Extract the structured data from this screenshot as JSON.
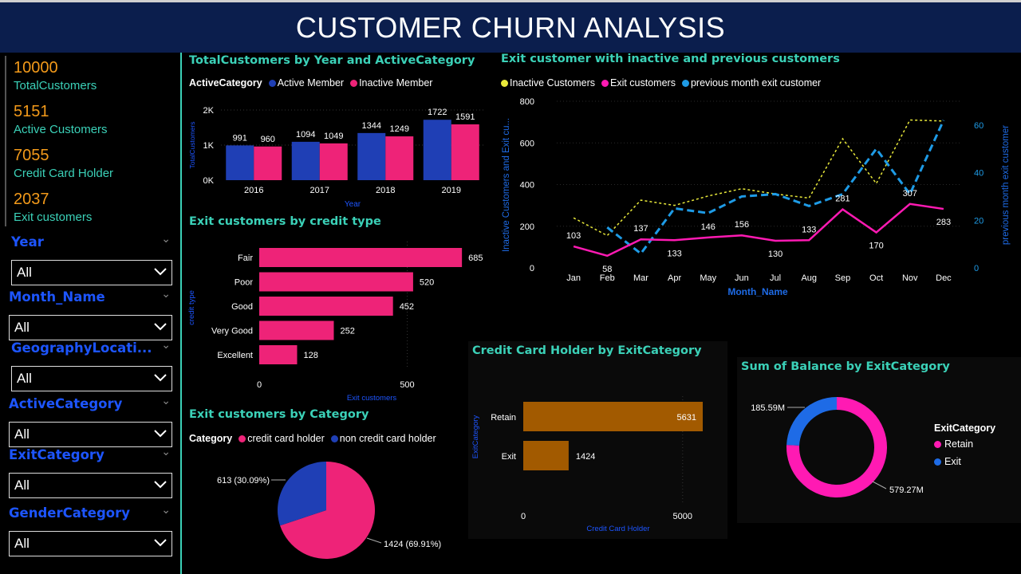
{
  "header": {
    "title": "CUSTOMER CHURN ANALYSIS"
  },
  "kpis": [
    {
      "value": "10000",
      "label": "TotalCustomers"
    },
    {
      "value": "5151",
      "label": "Active Customers"
    },
    {
      "value": "7055",
      "label": "Credit Card Holder"
    },
    {
      "value": "2037",
      "label": "Exit customers"
    }
  ],
  "slicers": [
    {
      "title": "Year",
      "value": "All"
    },
    {
      "title": "Month_Name",
      "value": "All"
    },
    {
      "title": "GeographyLocati...",
      "value": "All"
    },
    {
      "title": "ActiveCategory",
      "value": "All"
    },
    {
      "title": "ExitCategory",
      "value": "All"
    },
    {
      "title": "GenderCategory",
      "value": "All"
    }
  ],
  "colors": {
    "accent": "#3bd1b8",
    "kpi": "#f39a1a",
    "slicer": "#1d55ff",
    "blue": "#1f3fb5",
    "pink": "#ee2378",
    "magenta": "#ff1ab3",
    "yellow": "#e8e83a",
    "cyan": "#1e9be6",
    "brown": "#a25a00"
  },
  "charts": {
    "year_active": {
      "title": "TotalCustomers by Year and ActiveCategory",
      "legend_title": "ActiveCategory",
      "ylabel": "TotalCustomers",
      "xlabel": "Year",
      "yticks": [
        "0K",
        "1K",
        "2K"
      ]
    },
    "credit_type": {
      "title": "Exit customers by credit type",
      "ylabel": "credit type",
      "xlabel": "Exit customers",
      "xticks": [
        "0",
        "500"
      ]
    },
    "category_pie": {
      "title": "Exit customers by Category",
      "legend_title": "Category",
      "labels": [
        "613 (30.09%)",
        "1424 (69.91%)"
      ]
    },
    "monthly": {
      "title": "Exit customer with inactive and previous customers",
      "y1label": "Inactive Customers and Exit cu...",
      "y2label": "previous month exit customer",
      "xlabel": "Month_Name",
      "y1ticks": [
        "0",
        "200",
        "400",
        "600",
        "800"
      ],
      "y2ticks": [
        "0",
        "20",
        "40",
        "60"
      ]
    },
    "cc_holder": {
      "title": "Credit Card Holder by ExitCategory",
      "ylabel": "ExitCategory",
      "xlabel": "Credit Card Holder",
      "xticks": [
        "0",
        "5000"
      ]
    },
    "balance": {
      "title": "Sum of Balance by ExitCategory",
      "legend_title": "ExitCategory",
      "labels": [
        "185.59M",
        "579.27M"
      ]
    }
  },
  "chart_data": [
    {
      "type": "bar",
      "title": "TotalCustomers by Year and ActiveCategory",
      "xlabel": "Year",
      "ylabel": "TotalCustomers",
      "categories": [
        "2016",
        "2017",
        "2018",
        "2019"
      ],
      "series": [
        {
          "name": "Active Member",
          "values": [
            991,
            1094,
            1344,
            1722
          ]
        },
        {
          "name": "Inactive Member",
          "values": [
            960,
            1049,
            1249,
            1591
          ]
        }
      ],
      "ylim": [
        0,
        2000
      ]
    },
    {
      "type": "bar",
      "title": "Exit customers by credit type",
      "xlabel": "Exit customers",
      "ylabel": "credit type",
      "categories": [
        "Fair",
        "Poor",
        "Good",
        "Very Good",
        "Excellent"
      ],
      "values": [
        685,
        520,
        452,
        252,
        128
      ],
      "xlim": [
        0,
        685
      ]
    },
    {
      "type": "pie",
      "title": "Exit customers by Category",
      "categories": [
        "credit card holder",
        "non credit card holder"
      ],
      "values": [
        1424,
        613
      ]
    },
    {
      "type": "line",
      "title": "Exit customer with inactive and previous customers",
      "xlabel": "Month_Name",
      "x": [
        "Jan",
        "Feb",
        "Mar",
        "Apr",
        "May",
        "Jun",
        "Jul",
        "Aug",
        "Sep",
        "Oct",
        "Nov",
        "Dec"
      ],
      "series": [
        {
          "name": "Inactive Customers",
          "axis": "left",
          "values": [
            240,
            155,
            325,
            300,
            345,
            380,
            355,
            335,
            620,
            405,
            710,
            705
          ]
        },
        {
          "name": "Exit customers",
          "axis": "left",
          "values": [
            103,
            58,
            137,
            133,
            146,
            156,
            130,
            133,
            281,
            170,
            307,
            283
          ]
        },
        {
          "name": "previous month exit customer",
          "axis": "right",
          "values": [
            null,
            17,
            6,
            25,
            23,
            30,
            31,
            26,
            31,
            50,
            31,
            62
          ]
        }
      ],
      "ylim": [
        0,
        800
      ],
      "y2lim": [
        0,
        70
      ]
    },
    {
      "type": "bar",
      "title": "Credit Card Holder by ExitCategory",
      "xlabel": "Credit Card Holder",
      "ylabel": "ExitCategory",
      "categories": [
        "Retain",
        "Exit"
      ],
      "values": [
        5631,
        1424
      ],
      "xlim": [
        0,
        5631
      ]
    },
    {
      "type": "pie",
      "title": "Sum of Balance by ExitCategory",
      "categories": [
        "Retain",
        "Exit"
      ],
      "values": [
        579.27,
        185.59
      ]
    }
  ]
}
